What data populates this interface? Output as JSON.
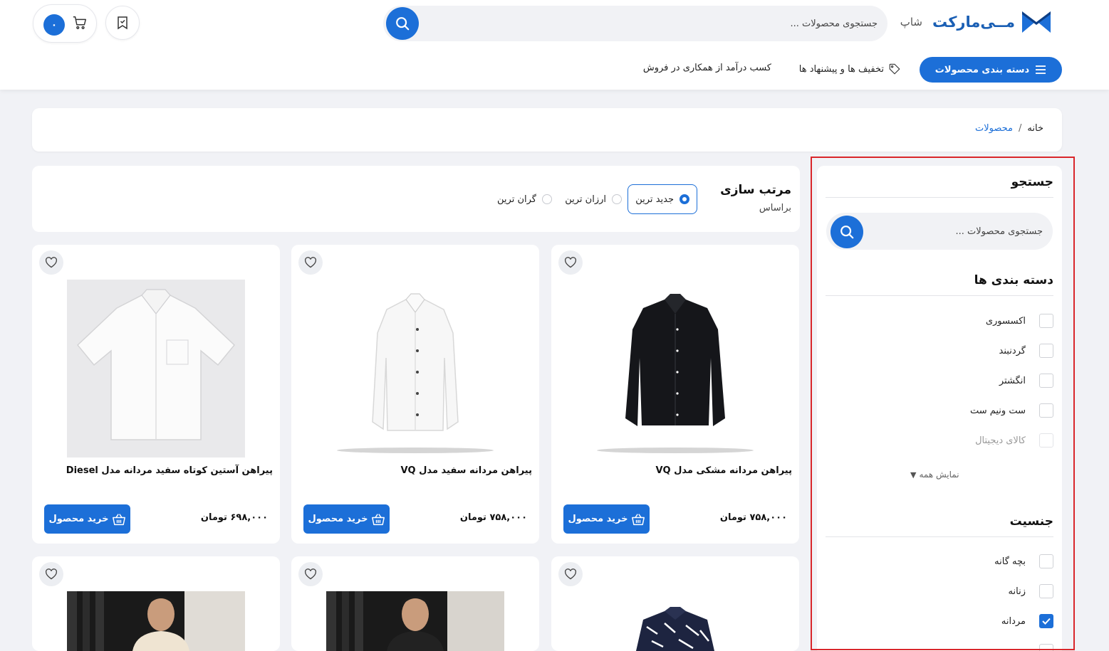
{
  "header": {
    "brand": "مــی‌مارکت",
    "brand_sub": "شاپ",
    "search_placeholder": "جستجوی محصولات ...",
    "cart_count": "۰",
    "categories_button": "دسته بندی محصولات",
    "nav": [
      {
        "label": "تخفیف ها و پیشنهاد ها"
      },
      {
        "label": "کسب درآمد از همکاری در فروش"
      }
    ]
  },
  "breadcrumb": {
    "home": "خانه",
    "separator": "/",
    "current": "محصولات"
  },
  "sidebar": {
    "search_title": "جستجو",
    "search_placeholder": "جستجوی محصولات ...",
    "categories_title": "دسته بندی ها",
    "categories": [
      {
        "label": "اکسسوری",
        "checked": false
      },
      {
        "label": "گردنبند",
        "checked": false
      },
      {
        "label": "انگشتر",
        "checked": false
      },
      {
        "label": "ست ونیم ست",
        "checked": false
      },
      {
        "label": "کالای دیجیتال",
        "checked": false
      }
    ],
    "show_all": "نمایش همه",
    "gender_title": "جنسیت",
    "genders": [
      {
        "label": "بچه گانه",
        "checked": false
      },
      {
        "label": "زنانه",
        "checked": false
      },
      {
        "label": "مردانه",
        "checked": true
      }
    ]
  },
  "sort": {
    "title": "مرتب سازی",
    "subtitle": "براساس",
    "options": [
      {
        "label": "جدید ترین",
        "selected": true
      },
      {
        "label": "ارزان ترین",
        "selected": false
      },
      {
        "label": "گران ترین",
        "selected": false
      }
    ]
  },
  "products": [
    {
      "name": "پیراهن مردانه مشکی مدل VQ",
      "price": "۷۵۸,۰۰۰ تومان",
      "buy_label": "خرید محصول"
    },
    {
      "name": "پیراهن مردانه سفید مدل VQ",
      "price": "۷۵۸,۰۰۰ تومان",
      "buy_label": "خرید محصول"
    },
    {
      "name": "پیراهن آستین کوتاه سفید مردانه مدل Diesel",
      "price": "۶۹۸,۰۰۰ تومان",
      "buy_label": "خرید محصول"
    }
  ],
  "colors": {
    "accent": "#1c6fd8",
    "highlight_border": "#d9262b",
    "background": "#f1f2f6"
  }
}
